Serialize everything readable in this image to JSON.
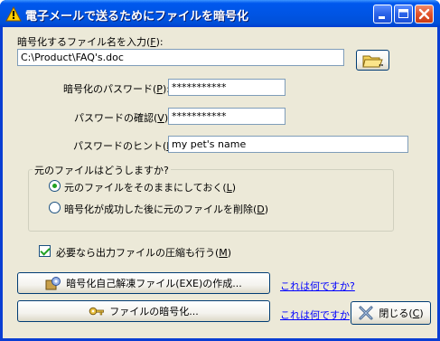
{
  "window": {
    "title": "電子メールで送るためにファイルを暗号化"
  },
  "file": {
    "label": "暗号化するファイル名を入力(",
    "accel": "F",
    "label_end": "):",
    "value": "C:\\Product\\FAQ's.doc"
  },
  "password": {
    "label": "暗号化のパスワード(",
    "accel": "P",
    "label_end": "):",
    "value": "***********"
  },
  "confirm": {
    "label": "パスワードの確認(",
    "accel": "V",
    "label_end": "):",
    "value": "***********"
  },
  "hint": {
    "label": "パスワードのヒント(",
    "accel": "H",
    "label_end": "):",
    "value": "my pet's name"
  },
  "original_group": {
    "title": "元のファイルはどうしますか?",
    "options": [
      {
        "label": "元のファイルをそのままにしておく(",
        "accel": "L",
        "label_end": ")",
        "checked": true
      },
      {
        "label": "暗号化が成功した後に元のファイルを削除(",
        "accel": "D",
        "label_end": ")",
        "checked": false
      }
    ]
  },
  "compress": {
    "label": "必要なら出力ファイルの圧縮も行う(",
    "accel": "M",
    "label_end": ")",
    "checked": true
  },
  "buttons": {
    "self_extract": "暗号化自己解凍ファイル(EXE)の作成...",
    "encrypt": "ファイルの暗号化...",
    "close_label": "閉じる(",
    "close_accel": "C",
    "close_end": ")"
  },
  "links": {
    "what_is_1": "これは何ですか?",
    "what_is_2": "これは何ですか"
  },
  "icons": {
    "title": "warning-triangle-icon",
    "browse": "folder-icon",
    "self_extract": "gear-package-icon",
    "encrypt": "key-icon",
    "close": "x-icon"
  }
}
